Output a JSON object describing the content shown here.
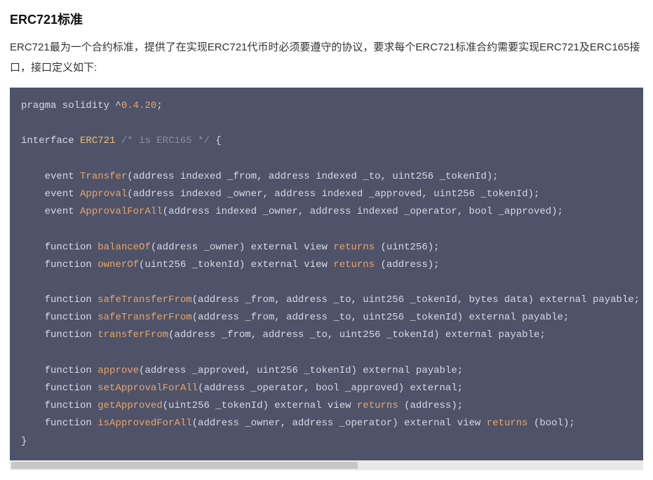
{
  "heading": "ERC721标准",
  "paragraph": "ERC721最为一个合约标准，提供了在实现ERC721代币时必须要遵守的协议，要求每个ERC721标准合约需要实现ERC721及ERC165接口，接口定义如下:",
  "code": {
    "pragma_kw": "pragma solidity ^",
    "pragma_ver": "0.4.20",
    "semicolon": ";",
    "interface_kw": "interface",
    "interface_name": "ERC721",
    "interface_cmt": "/* is ERC165 */",
    "brace_open": "{",
    "brace_close": "}",
    "event_kw": "event",
    "function_kw": "function",
    "returns_kw": "returns",
    "events": {
      "transfer_name": "Transfer",
      "transfer_sig": "(address indexed _from, address indexed _to, uint256 _tokenId);",
      "approval_name": "Approval",
      "approval_sig": "(address indexed _owner, address indexed _approved, uint256 _tokenId);",
      "approvalforall_name": "ApprovalForAll",
      "approvalforall_sig": "(address indexed _owner, address indexed _operator, bool _approved);"
    },
    "fns": {
      "balanceOf_name": "balanceOf",
      "balanceOf_sig": "(address _owner) external view ",
      "balanceOf_ret": " (uint256);",
      "ownerOf_name": "ownerOf",
      "ownerOf_sig": "(uint256 _tokenId) external view ",
      "ownerOf_ret": " (address);",
      "safeTransferFrom1_name": "safeTransferFrom",
      "safeTransferFrom1_sig": "(address _from, address _to, uint256 _tokenId, bytes data) external payable;",
      "safeTransferFrom2_name": "safeTransferFrom",
      "safeTransferFrom2_sig": "(address _from, address _to, uint256 _tokenId) external payable;",
      "transferFrom_name": "transferFrom",
      "transferFrom_sig": "(address _from, address _to, uint256 _tokenId) external payable;",
      "approve_name": "approve",
      "approve_sig": "(address _approved, uint256 _tokenId) external payable;",
      "setApprovalForAll_name": "setApprovalForAll",
      "setApprovalForAll_sig": "(address _operator, bool _approved) external;",
      "getApproved_name": "getApproved",
      "getApproved_sig": "(uint256 _tokenId) external view ",
      "getApproved_ret": " (address);",
      "isApprovedForAll_name": "isApprovedForAll",
      "isApprovedForAll_sig": "(address _owner, address _operator) external view ",
      "isApprovedForAll_ret": " (bool);"
    }
  }
}
